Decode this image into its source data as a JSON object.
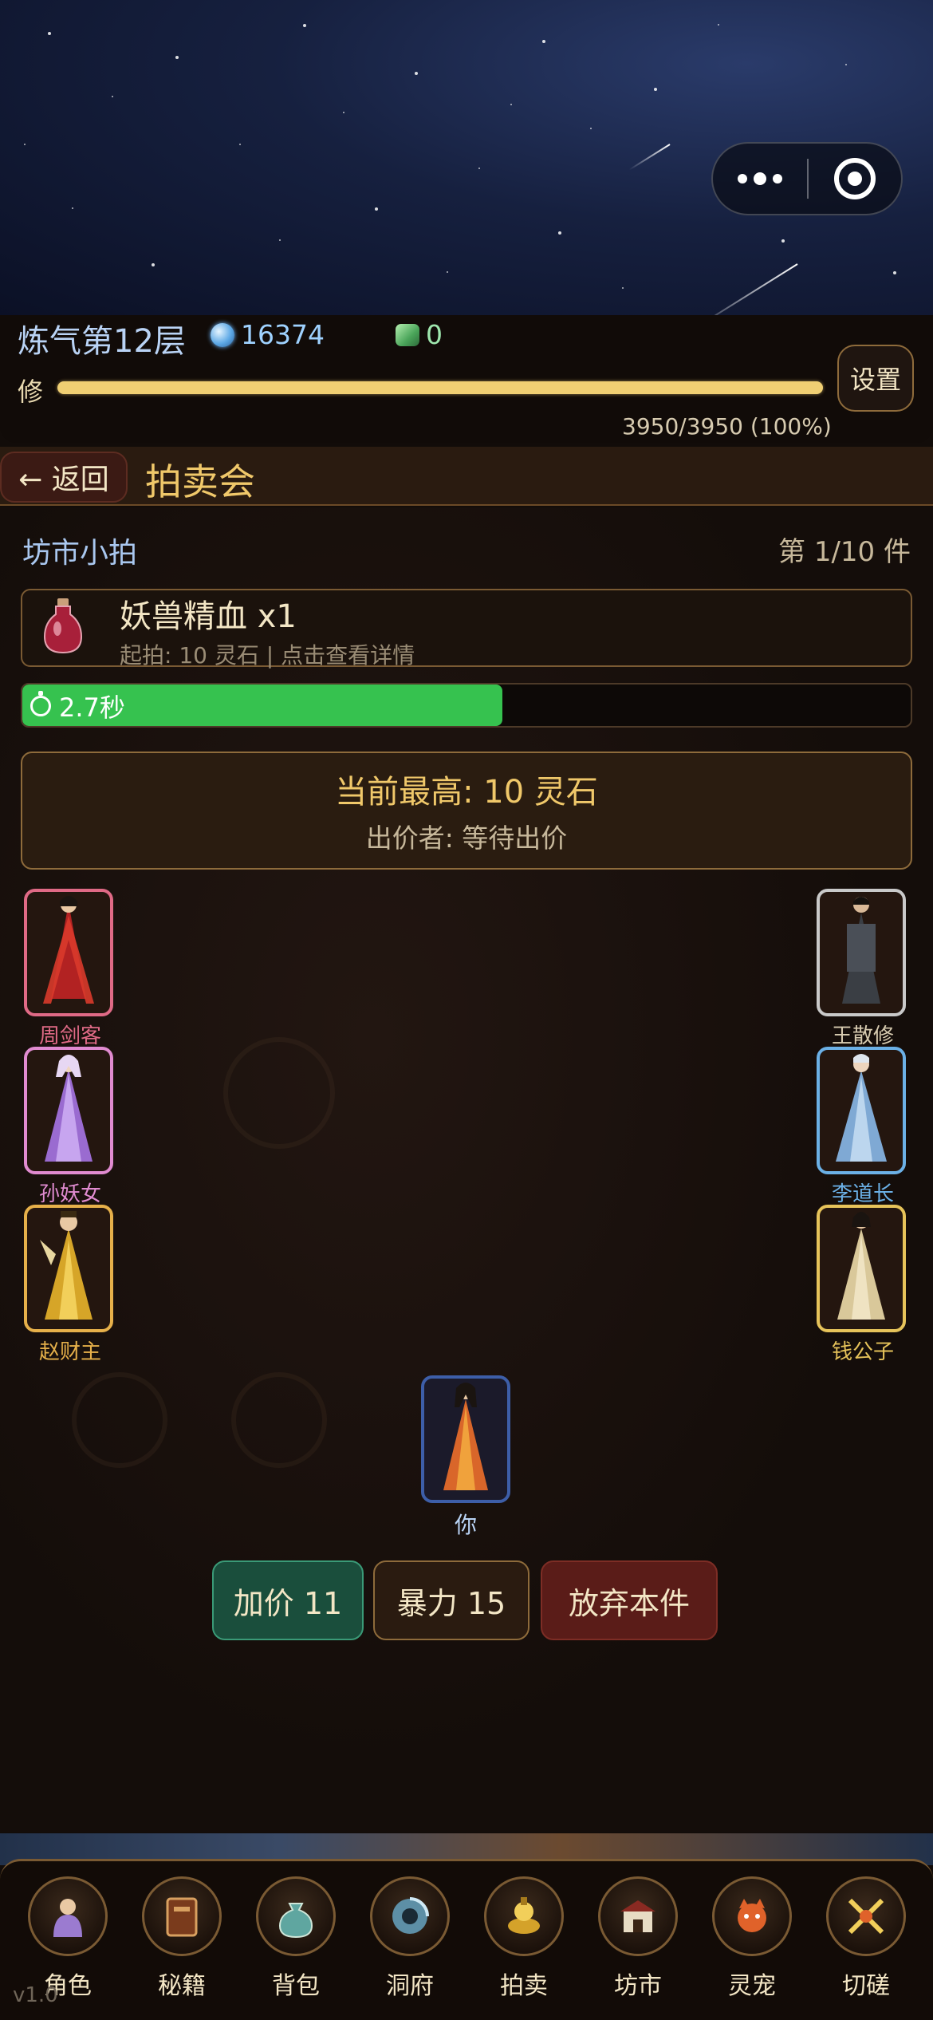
{
  "status": {
    "realm": "炼气第12层",
    "spirit_stones": "16374",
    "jade": "0",
    "cultivation_label": "修",
    "cultivation_progress": 1.0,
    "cultivation_text": "3950/3950 (100%)",
    "settings_label": "设置"
  },
  "titlebar": {
    "back_label": "← 返回",
    "title": "拍卖会"
  },
  "auction": {
    "market_name": "坊市小拍",
    "lot_count": "第 1/10 件",
    "item_name": "妖兽精血 x1",
    "item_sub": "起拍: 10 灵石 | 点击查看详情",
    "timer_text": "2.7秒",
    "timer_fraction": 0.54,
    "highest_bid": "当前最高: 10 灵石",
    "bidder": "出价者: 等待出价"
  },
  "bidders": [
    {
      "name": "周剑客",
      "color": "#e06a86"
    },
    {
      "name": "孙妖女",
      "color": "#e08bd0"
    },
    {
      "name": "赵财主",
      "color": "#e6b04a"
    },
    {
      "name": "王散修",
      "color": "#c9c9c9"
    },
    {
      "name": "李道长",
      "color": "#6bb0e6"
    },
    {
      "name": "钱公子",
      "color": "#e6c35a"
    }
  ],
  "you": {
    "name": "你"
  },
  "actions": {
    "raise": "加价 11",
    "force": "暴力 15",
    "quit": "放弃本件"
  },
  "nav": {
    "items": [
      {
        "label": "角色",
        "icon": "character-icon"
      },
      {
        "label": "秘籍",
        "icon": "book-icon"
      },
      {
        "label": "背包",
        "icon": "bag-icon"
      },
      {
        "label": "洞府",
        "icon": "cave-icon"
      },
      {
        "label": "拍卖",
        "icon": "auction-icon"
      },
      {
        "label": "坊市",
        "icon": "market-icon"
      },
      {
        "label": "灵宠",
        "icon": "pet-icon"
      },
      {
        "label": "切磋",
        "icon": "duel-icon"
      }
    ],
    "version": "v1.0"
  },
  "colors": {
    "accent_gold": "#f0c86a",
    "timer_green": "#36c24f",
    "raise_green": "#1a4e3c",
    "quit_red": "#5a1c18"
  }
}
